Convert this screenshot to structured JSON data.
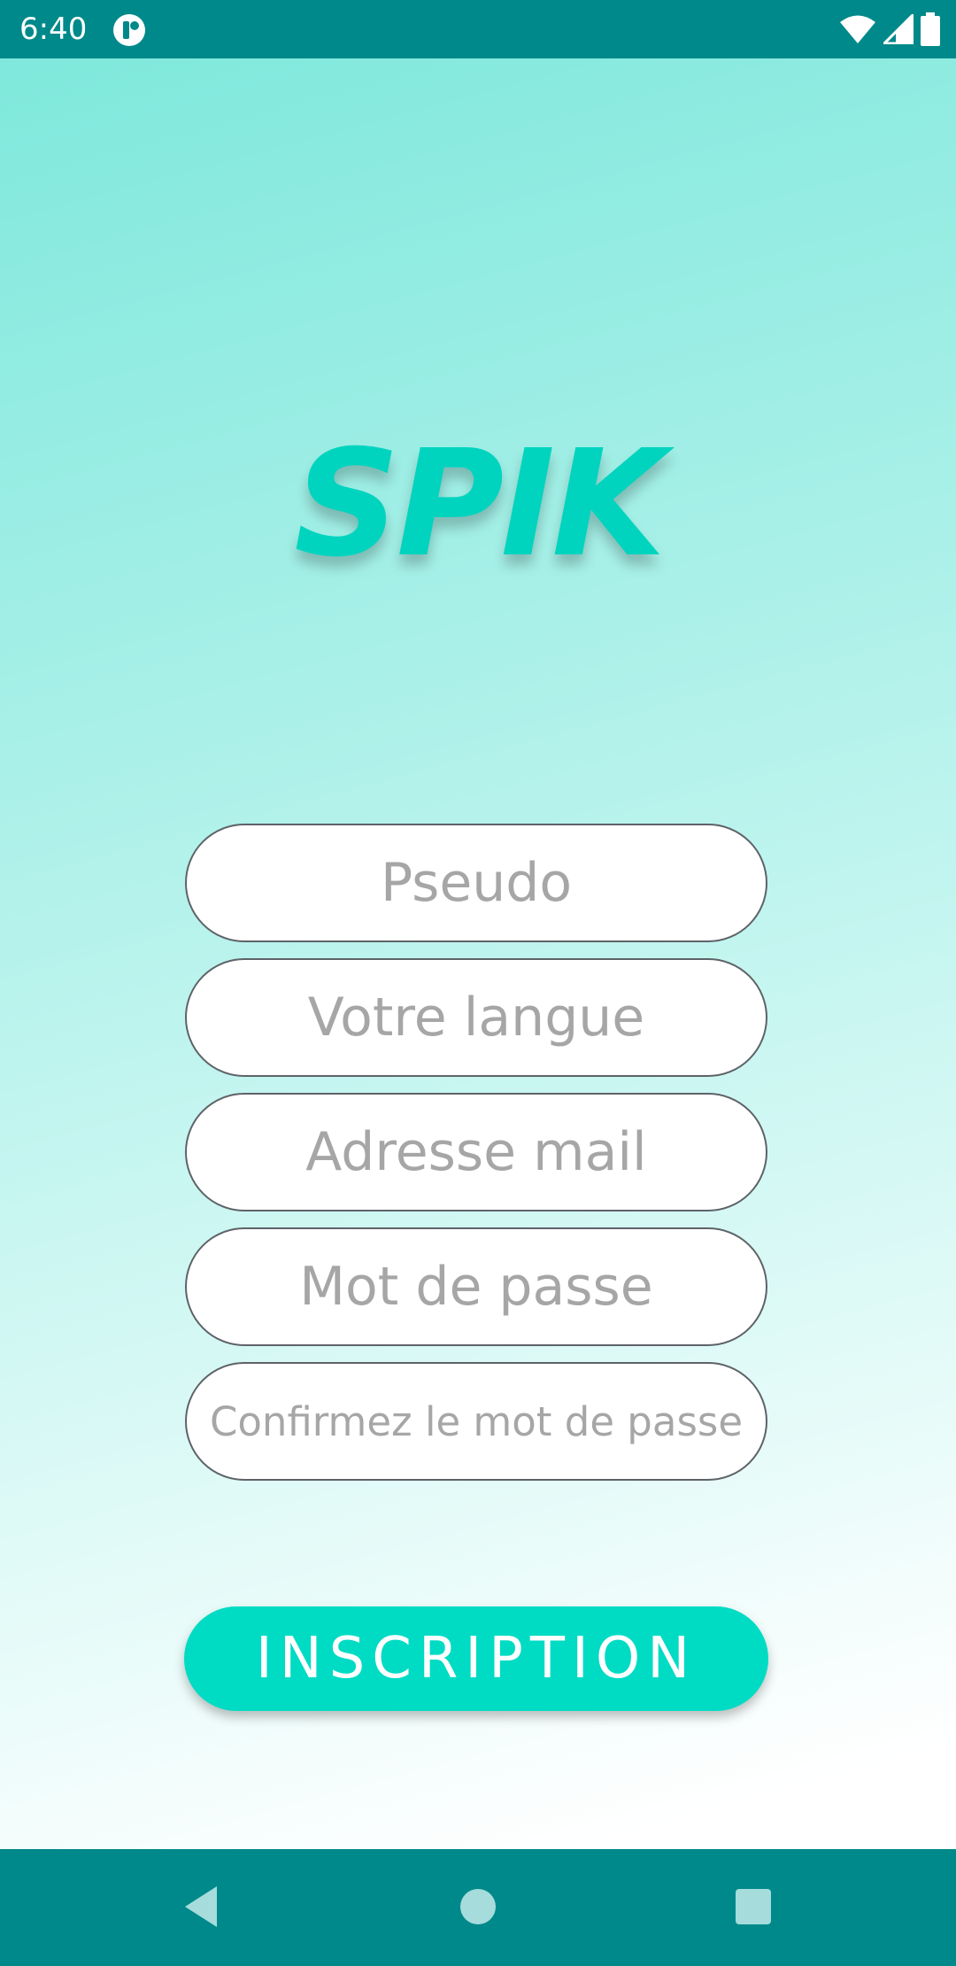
{
  "status_bar": {
    "time": "6:40",
    "app_icon": "notification-app-icon",
    "icons": [
      "wifi-icon",
      "signal-icon",
      "battery-icon"
    ]
  },
  "app": {
    "logo": "SPIK"
  },
  "form": {
    "fields": [
      {
        "placeholder": "Pseudo",
        "type": "text"
      },
      {
        "placeholder": "Votre langue",
        "type": "text"
      },
      {
        "placeholder": "Adresse mail",
        "type": "email"
      },
      {
        "placeholder": "Mot de passe",
        "type": "password"
      },
      {
        "placeholder": "Confirmez le mot de passe",
        "type": "password"
      }
    ],
    "submit_label": "INSCRIPTION"
  },
  "nav_bar": {
    "buttons": [
      "back-icon",
      "home-icon",
      "recents-icon"
    ]
  },
  "colors": {
    "status_bar": "#00898a",
    "accent": "#00dbc4",
    "logo": "#00d4bf",
    "gradient_top": "#7fe8dc",
    "gradient_bottom": "#ffffff"
  }
}
